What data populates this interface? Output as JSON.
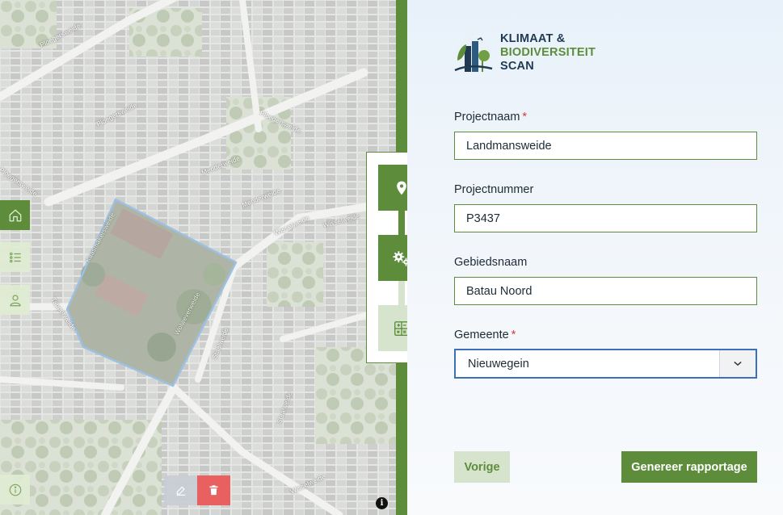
{
  "app": {
    "logo": {
      "line1": "KLIMAAT &",
      "line2": "BIODIVERSITEIT",
      "line3": "SCAN"
    }
  },
  "map": {
    "street_labels": [
      "Ploegersweide",
      "Ploegersweide",
      "Ploegersweide",
      "Ploegersweide",
      "Menderweide",
      "Menderweide",
      "Wisselweide",
      "Wisselweide",
      "Wolweverweide",
      "Kaasmakersweide",
      "Tapperweide",
      "Staalweide",
      "Staalweide",
      "Wisselweide"
    ],
    "attribution_icon": "info-icon"
  },
  "sidebar": {
    "buttons": [
      {
        "icon": "home-icon",
        "active": true
      },
      {
        "icon": "list-icon",
        "active": false
      },
      {
        "icon": "user-icon",
        "active": false
      }
    ],
    "info_icon": "info-circle-icon"
  },
  "stepper": {
    "steps": [
      {
        "icon": "location-pin-icon",
        "state": "done"
      },
      {
        "icon": "gears-icon",
        "state": "done"
      },
      {
        "icon": "calculator-icon",
        "state": "todo"
      }
    ]
  },
  "form": {
    "fields": [
      {
        "label": "Projectnaam",
        "required": true,
        "value": "Landmansweide"
      },
      {
        "label": "Projectnummer",
        "required": false,
        "value": "P3437"
      },
      {
        "label": "Gebiedsnaam",
        "required": false,
        "value": "Batau Noord"
      }
    ],
    "gemeente": {
      "label": "Gemeente",
      "required": true,
      "selected": "Nieuwegein"
    },
    "required_marker": "*"
  },
  "actions": {
    "previous_label": "Vorige",
    "generate_label": "Genereer rapportage"
  },
  "colors": {
    "primary_green": "#5d8d3a",
    "light_green": "#d7e4cd",
    "focus_blue": "#3d70b8",
    "polygon_blue": "#3b82c4",
    "delete_red": "#e86060"
  }
}
